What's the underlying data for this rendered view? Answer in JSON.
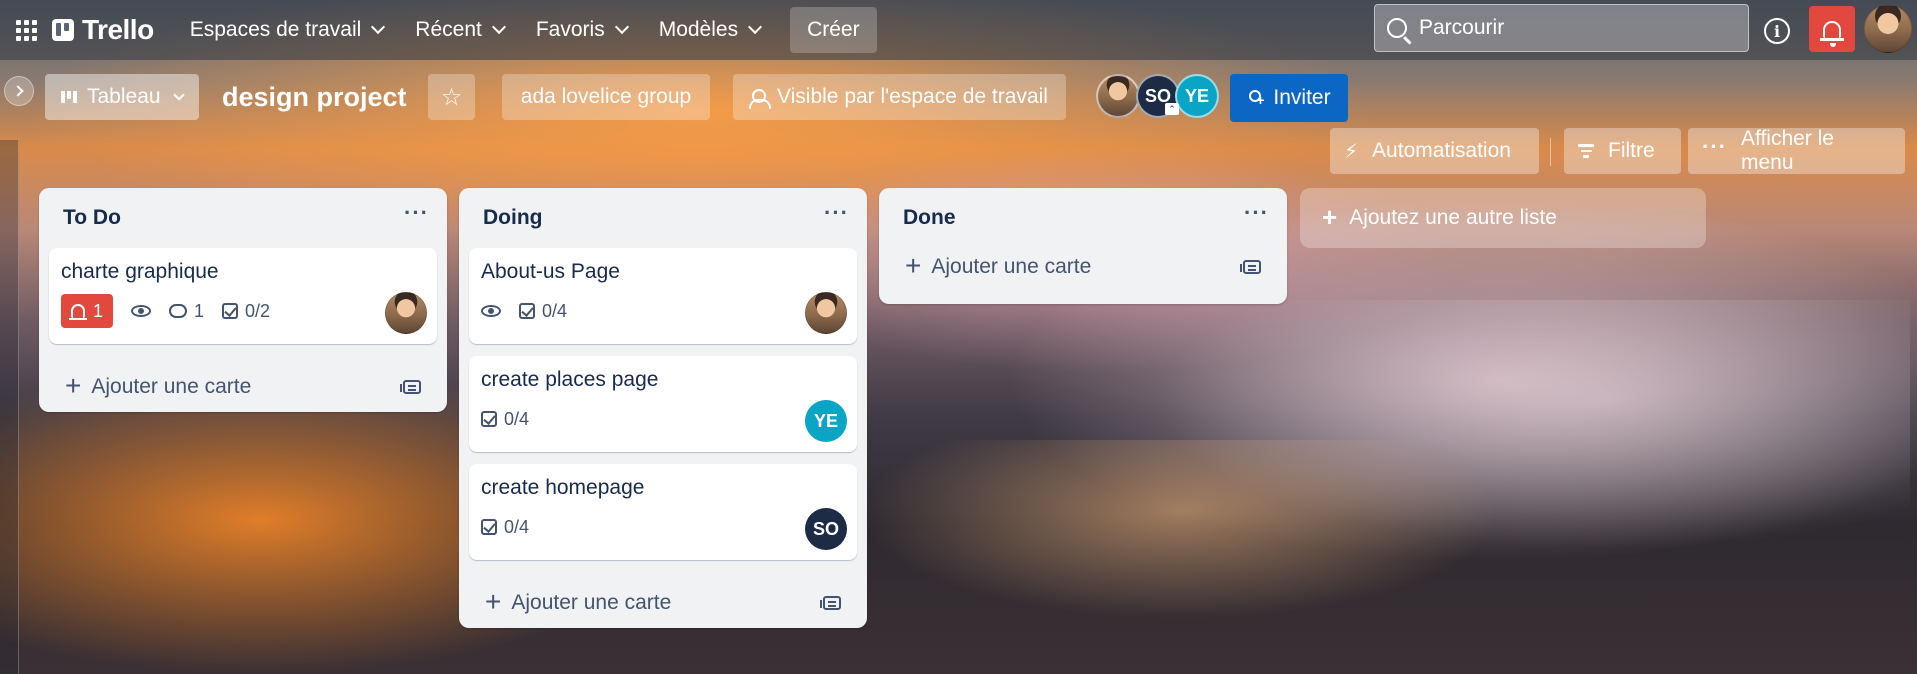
{
  "topbar": {
    "app_name": "Trello",
    "nav": [
      {
        "label": "Espaces de travail"
      },
      {
        "label": "Récent"
      },
      {
        "label": "Favoris"
      },
      {
        "label": "Modèles"
      }
    ],
    "create_label": "Créer",
    "search_placeholder": "Parcourir",
    "info_glyph": "i"
  },
  "board": {
    "view_label": "Tableau",
    "title": "design project",
    "star_glyph": "☆",
    "workspace_label": "ada lovelice group",
    "visibility_label": "Visible par l'espace de travail",
    "members": [
      "SO",
      "YE"
    ],
    "invite_label": "Inviter",
    "automation_label": "Automatisation",
    "filter_label": "Filtre",
    "menu_label": "Afficher le menu",
    "add_list_label": "Ajoutez une autre liste"
  },
  "lists": [
    {
      "title": "To Do",
      "add_card_label": "Ajouter une carte",
      "cards": [
        {
          "title": "charte graphique",
          "notification_count": "1",
          "comment_count": "1",
          "checklist": "0/2"
        }
      ]
    },
    {
      "title": "Doing",
      "add_card_label": "Ajouter une carte",
      "cards": [
        {
          "title": "About-us Page",
          "checklist": "0/4"
        },
        {
          "title": "create places page",
          "checklist": "0/4",
          "member": "YE"
        },
        {
          "title": "create homepage",
          "checklist": "0/4",
          "member": "SO"
        }
      ]
    },
    {
      "title": "Done",
      "add_card_label": "Ajouter une carte",
      "cards": []
    }
  ],
  "icons": {
    "apps": "grid-icon",
    "search": "search-icon",
    "info": "info-icon",
    "notifications": "bell-icon",
    "star": "star-icon",
    "visibility": "people-icon",
    "automation": "lightning-icon",
    "filter": "filter-icon",
    "menu": "ellipsis-icon",
    "watch": "eye-icon",
    "comment": "comment-icon",
    "checklist": "checkbox-icon",
    "template": "card-template-icon"
  },
  "colors": {
    "invite_button": "#0c66c4",
    "notification_red": "#e2483d",
    "member_so": "#1d2b45",
    "member_ye": "#0aa5c4",
    "list_bg": "#f1f2f4"
  }
}
